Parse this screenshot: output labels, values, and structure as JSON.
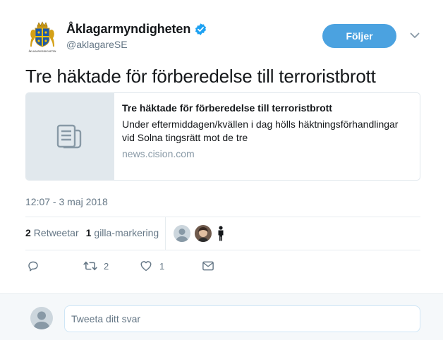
{
  "header": {
    "fullname": "Åklagarmyndigheten",
    "handle": "@aklagareSE",
    "avatar_caption": "ÅKLAGARMYNDIGHETEN",
    "follow_label": "Följer",
    "verified": true
  },
  "tweet": {
    "text": "Tre häktade för förberedelse till terroristbrott",
    "timestamp": "12:07 - 3 maj 2018"
  },
  "card": {
    "title": "Tre häktade för förberedelse till terroristbrott",
    "description_line1": "Under eftermiddagen/kvällen i dag hölls häktningsförhandlingar",
    "description_line2": "vid Solna tingsrätt mot de tre",
    "domain": "news.cision.com",
    "thumb_icon": "document-icon"
  },
  "stats": {
    "retweets_count": "2",
    "retweets_label": "Retweetar",
    "likes_count": "1",
    "likes_label": "gilla-markering"
  },
  "actions": {
    "reply_count": "",
    "retweet_count": "2",
    "like_count": "1"
  },
  "reply": {
    "placeholder": "Tweeta ditt svar"
  },
  "colors": {
    "accent": "#4ba2e0",
    "secondary_text": "#657786",
    "divider": "#e6ecf0"
  }
}
